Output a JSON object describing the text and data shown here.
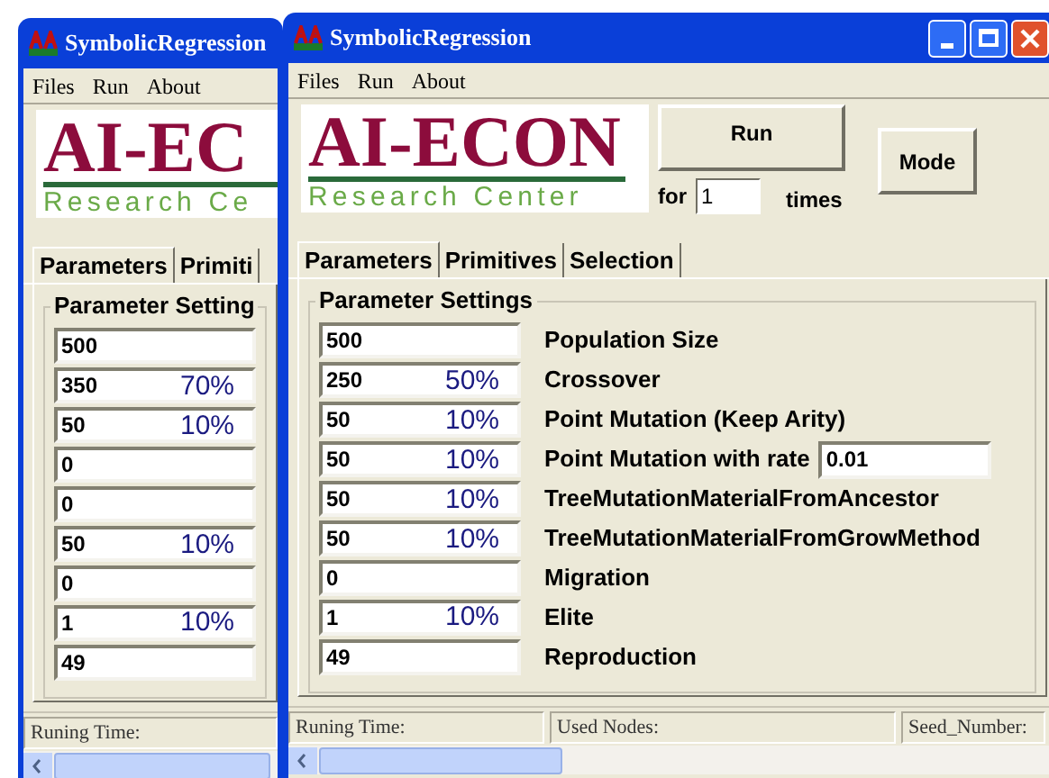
{
  "windows": [
    {
      "title": "SymbolicRegression",
      "menu": [
        "Files",
        "Run",
        "About"
      ],
      "logo": {
        "name": "AI-EC",
        "subtitle": "Research Ce"
      },
      "tabs": [
        {
          "label": "Parameters",
          "selected": true
        },
        {
          "label": "Primiti",
          "selected": false
        }
      ],
      "group_title": "Parameter Setting",
      "rows": [
        {
          "value": "500"
        },
        {
          "value": "350",
          "percent": "70%"
        },
        {
          "value": "50",
          "percent": "10%"
        },
        {
          "value": "0"
        },
        {
          "value": "0"
        },
        {
          "value": "50",
          "percent": "10%"
        },
        {
          "value": "0"
        },
        {
          "value": "1",
          "percent": "10%",
          "percent_spans_next": true
        },
        {
          "value": "49"
        }
      ],
      "status_bar": [
        "Runing Time:"
      ]
    },
    {
      "title": "SymbolicRegression",
      "menu": [
        "Files",
        "Run",
        "About"
      ],
      "logo": {
        "name": "AI-ECON",
        "subtitle": "Research Center"
      },
      "run_button": "Run",
      "repeat": {
        "prefix": "for",
        "value": "1",
        "suffix": "times"
      },
      "mode_button": "Mode",
      "tabs": [
        {
          "label": "Parameters",
          "selected": true
        },
        {
          "label": "Primitives",
          "selected": false
        },
        {
          "label": "Selection",
          "selected": false
        }
      ],
      "group_title": "Parameter Settings",
      "rows": [
        {
          "value": "500",
          "label": "Population Size"
        },
        {
          "value": "250",
          "percent": "50%",
          "label": "Crossover"
        },
        {
          "value": "50",
          "percent": "10%",
          "label": "Point Mutation (Keep Arity)"
        },
        {
          "value": "50",
          "percent": "10%",
          "label": "Point Mutation with rate",
          "rate": "0.01"
        },
        {
          "value": "50",
          "percent": "10%",
          "label": "TreeMutationMaterialFromAncestor"
        },
        {
          "value": "50",
          "percent": "10%",
          "label": "TreeMutationMaterialFromGrowMethod"
        },
        {
          "value": "0",
          "label": "Migration"
        },
        {
          "value": "1",
          "percent": "10%",
          "percent_spans_next": true,
          "label": "Elite"
        },
        {
          "value": "49",
          "label": "Reproduction"
        }
      ],
      "status_bar": [
        "Runing Time:",
        "Used Nodes:",
        "Seed_Number:"
      ]
    }
  ]
}
